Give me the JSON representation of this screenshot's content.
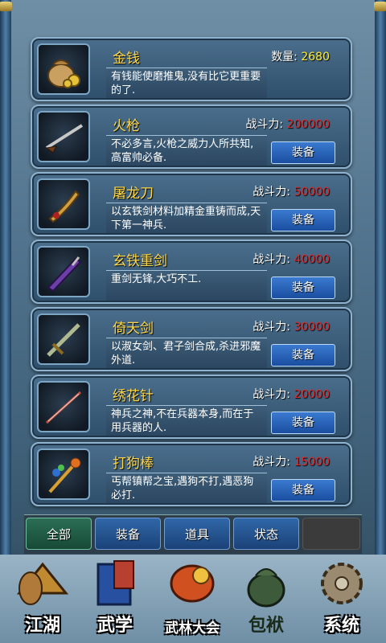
{
  "items": [
    {
      "name": "金钱",
      "stat_label": "数量:",
      "stat_value": "2680",
      "desc": "有钱能使磨推鬼,没有比它更重要的了.",
      "icon": "money-bag-icon",
      "has_button": false
    },
    {
      "name": "火枪",
      "stat_label": "战斗力:",
      "stat_value": "200000",
      "desc": "不必多言,火枪之威力人所共知,高富帅必备.",
      "icon": "musket-icon",
      "has_button": true
    },
    {
      "name": "屠龙刀",
      "stat_label": "战斗力:",
      "stat_value": "50000",
      "desc": "以玄铁剑材料加精金重铸而成,天下第一神兵.",
      "icon": "dragon-saber-icon",
      "has_button": true
    },
    {
      "name": "玄铁重剑",
      "stat_label": "战斗力:",
      "stat_value": "40000",
      "desc": "重剑无锋,大巧不工.",
      "icon": "heavy-sword-icon",
      "has_button": true
    },
    {
      "name": "倚天剑",
      "stat_label": "战斗力:",
      "stat_value": "30000",
      "desc": "以淑女剑、君子剑合成,杀进邪魔外道.",
      "icon": "heaven-sword-icon",
      "has_button": true
    },
    {
      "name": "绣花针",
      "stat_label": "战斗力:",
      "stat_value": "20000",
      "desc": "神兵之神,不在兵器本身,而在于用兵器的人.",
      "icon": "needle-icon",
      "has_button": true
    },
    {
      "name": "打狗棒",
      "stat_label": "战斗力:",
      "stat_value": "15000",
      "desc": "丐帮镇帮之宝,遇狗不打,遇恶狗必打.",
      "icon": "dog-stick-icon",
      "has_button": true
    }
  ],
  "equip_label": "装备",
  "tabs": [
    "全部",
    "装备",
    "道具",
    "状态"
  ],
  "nav": [
    {
      "label": "江湖",
      "icon": "jianghu-hat-icon"
    },
    {
      "label": "武学",
      "icon": "martial-book-icon"
    },
    {
      "label": "武林大会",
      "icon": "tournament-drum-icon"
    },
    {
      "label": "包袱",
      "icon": "bundle-sack-icon"
    },
    {
      "label": "系统",
      "icon": "settings-gear-icon"
    }
  ],
  "colors": {
    "name": "#ffd84a",
    "power": "#e02a2a",
    "money": "#ffee33",
    "button": "#2563b8"
  }
}
